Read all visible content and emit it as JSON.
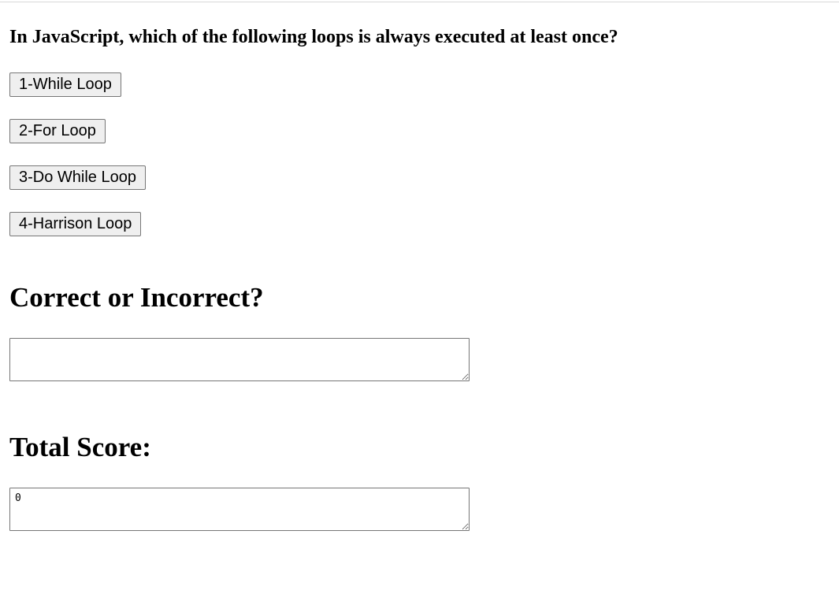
{
  "question": {
    "text": "In JavaScript, which of the following loops is always executed at least once?"
  },
  "answers": [
    {
      "label": "1-While Loop"
    },
    {
      "label": "2-For Loop"
    },
    {
      "label": "3-Do While Loop"
    },
    {
      "label": "4-Harrison Loop"
    }
  ],
  "result": {
    "heading": "Correct or Incorrect?",
    "value": ""
  },
  "score": {
    "heading": "Total Score:",
    "value": "0"
  }
}
